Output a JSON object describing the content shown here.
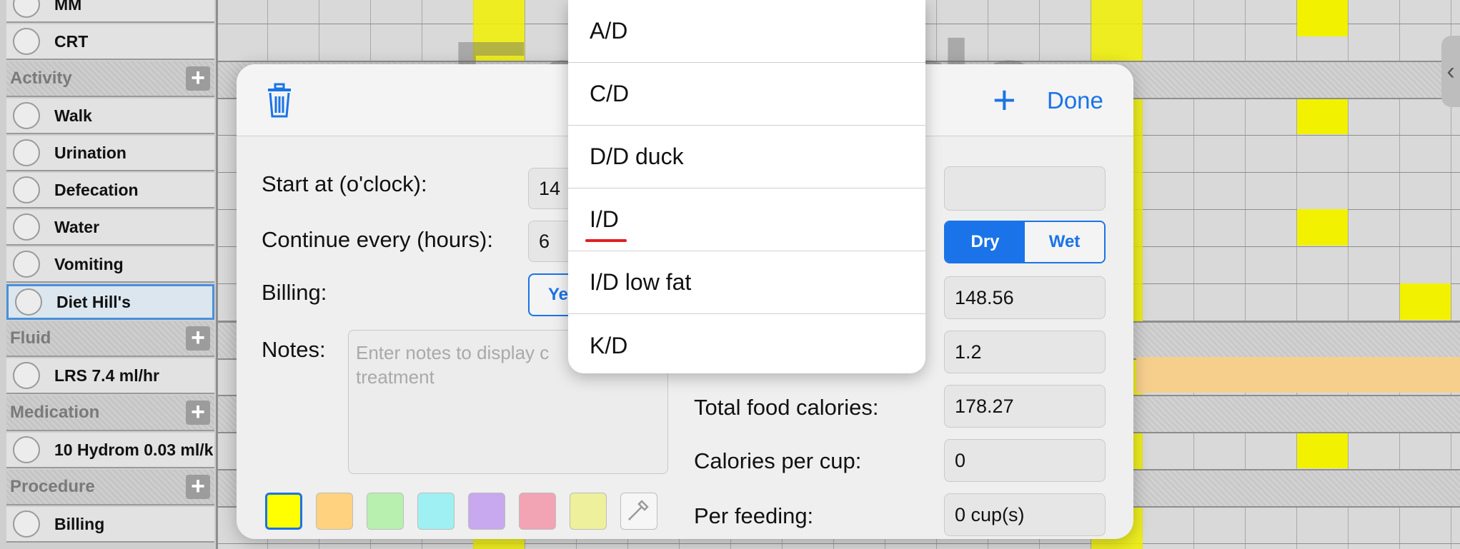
{
  "watermark": "Edit Mode",
  "left_list": {
    "rows": [
      {
        "type": "item",
        "label": "MM"
      },
      {
        "type": "item",
        "label": "CRT"
      },
      {
        "type": "header",
        "label": "Activity"
      },
      {
        "type": "item",
        "label": "Walk"
      },
      {
        "type": "item",
        "label": "Urination"
      },
      {
        "type": "item",
        "label": "Defecation"
      },
      {
        "type": "item",
        "label": "Water"
      },
      {
        "type": "item",
        "label": "Vomiting"
      },
      {
        "type": "item",
        "label": "Diet Hill's",
        "selected": true
      },
      {
        "type": "header",
        "label": "Fluid"
      },
      {
        "type": "item",
        "label": "LRS 7.4 ml/hr"
      },
      {
        "type": "header",
        "label": "Medication"
      },
      {
        "type": "item",
        "label": "10 Hydrom 0.03 ml/k"
      },
      {
        "type": "header",
        "label": "Procedure"
      },
      {
        "type": "item",
        "label": "Billing"
      }
    ]
  },
  "popover": {
    "header": {
      "plus_label": "+",
      "done_label": "Done"
    },
    "start_label": "Start at (o'clock):",
    "start_value": "14",
    "continue_label": "Continue every (hours):",
    "continue_value": "6",
    "billing_label": "Billing:",
    "billing_button": "Ye",
    "notes_label": "Notes:",
    "notes_placeholder": "Enter notes to display c\ntreatment",
    "food_type_value": "",
    "dry_label": "Dry",
    "wet_label": "Wet",
    "value_1": "148.56",
    "value_2": "1.2",
    "total_calories_label": "Total food calories:",
    "total_calories_value": "178.27",
    "calories_per_cup_label": "Calories per cup:",
    "calories_per_cup_value": "0",
    "per_feeding_label": "Per feeding:",
    "per_feeding_value": "0 cup(s)",
    "swatches": [
      "#ffff00",
      "#ffd27f",
      "#b8f0b0",
      "#9ff0f2",
      "#c8a8ee",
      "#f2a3b4",
      "#eef09c"
    ]
  },
  "dropdown": {
    "options": [
      "A/D",
      "C/D",
      "D/D duck",
      "I/D",
      "I/D low fat",
      "K/D"
    ],
    "highlighted": "I/D"
  }
}
